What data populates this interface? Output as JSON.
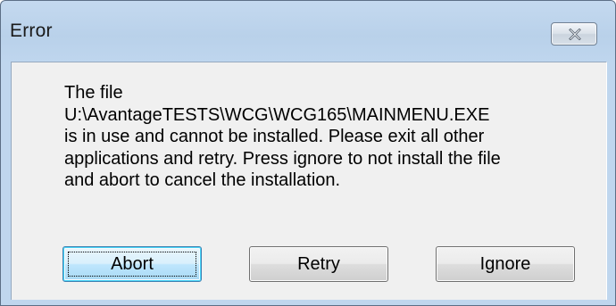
{
  "window": {
    "title": "Error"
  },
  "message": {
    "lines": [
      "The file",
      "U:\\AvantageTESTS\\WCG\\WCG165\\MAINMENU.EXE",
      "is in use and cannot be installed.  Please exit all other",
      "applications and retry.  Press ignore to not install the file",
      "and abort to cancel the installation."
    ]
  },
  "buttons": {
    "abort": "Abort",
    "retry": "Retry",
    "ignore": "Ignore"
  },
  "icons": {
    "close": "close-icon"
  },
  "colors": {
    "title_bar": "#b9d1ea",
    "client_background": "#f0f0f0",
    "default_button_border": "#3c7fb1"
  }
}
